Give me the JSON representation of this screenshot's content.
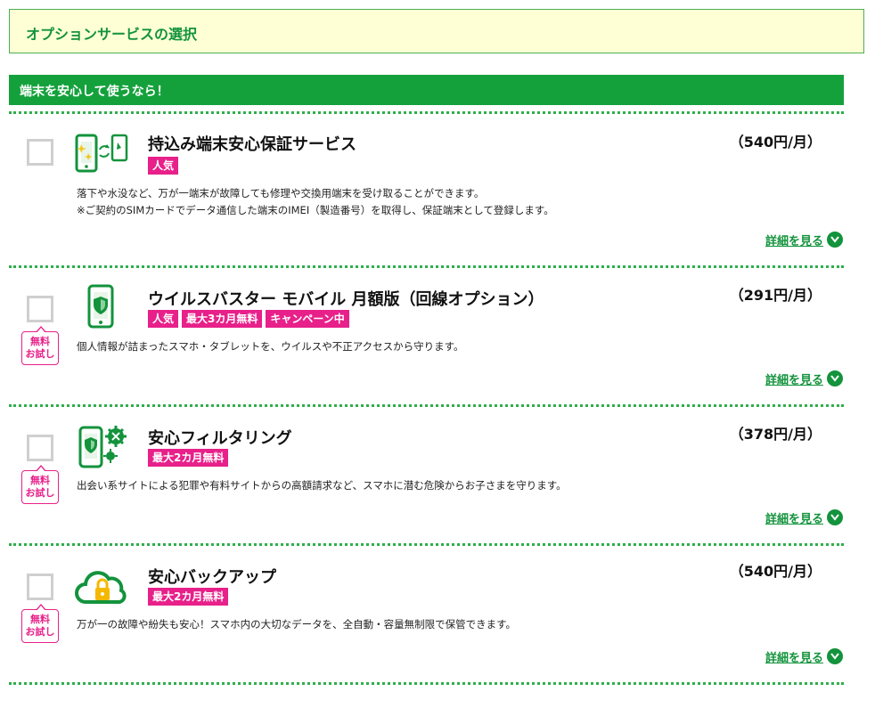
{
  "header": {
    "title": "オプションサービスの選択"
  },
  "category": {
    "label": "端末を安心して使うなら！"
  },
  "trial_label": {
    "line1": "無料",
    "line2": "お試し"
  },
  "detail_label": "詳細を見る",
  "colors": {
    "brand_green": "#14a13c",
    "badge_pink": "#e8208a",
    "header_bg": "#ffffd6"
  },
  "items": [
    {
      "name": "持込み端末安心保証サービス",
      "price": "（540円/月）",
      "badges": [
        "人気"
      ],
      "desc": [
        "落下や水没など、万が一端末が故障しても修理や交換用端末を受け取ることができます。",
        "※ご契約のSIMカードでデータ通信した端末のIMEI（製造番号）を取得し、保証端末として登録します。"
      ],
      "icon": "phone-swap-icon",
      "trial": false
    },
    {
      "name": "ウイルスバスター モバイル 月額版（回線オプション）",
      "price": "（291円/月）",
      "badges": [
        "人気",
        "最大3カ月無料",
        "キャンペーン中"
      ],
      "desc": [
        "個人情報が詰まったスマホ・タブレットを、ウイルスや不正アクセスから守ります。"
      ],
      "icon": "phone-shield-icon",
      "trial": true
    },
    {
      "name": "安心フィルタリング",
      "price": "（378円/月）",
      "badges": [
        "最大2カ月無料"
      ],
      "desc": [
        "出会い系サイトによる犯罪や有料サイトからの高額請求など、スマホに潜む危険からお子さまを守ります。"
      ],
      "icon": "phone-filter-icon",
      "trial": true
    },
    {
      "name": "安心バックアップ",
      "price": "（540円/月）",
      "badges": [
        "最大2カ月無料"
      ],
      "desc": [
        "万が一の故障や紛失も安心！スマホ内の大切なデータを、全自動・容量無制限で保管できます。"
      ],
      "icon": "cloud-lock-icon",
      "trial": true
    }
  ]
}
